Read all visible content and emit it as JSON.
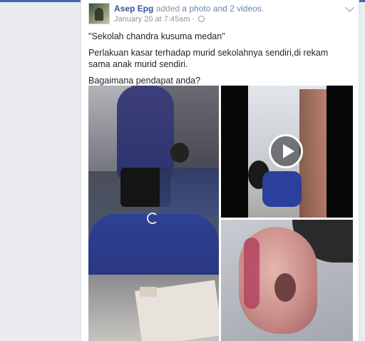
{
  "post": {
    "author": "Asep Epg",
    "action": "added",
    "action_link": "a photo and 2 videos",
    "action_suffix": ".",
    "timestamp": "January 20 at 7:45am",
    "separator": "·",
    "privacy_icon": "globe-icon",
    "paragraphs": [
      "\"Sekolah chandra kusuma medan\"",
      "Perlakuan kasar terhadap murid sekolahnya sendiri,di rekam sama anak murid sendiri.",
      "Bagaimana pendapat anda?"
    ],
    "media": [
      {
        "kind": "photo",
        "icon": "loading-spinner-icon"
      },
      {
        "kind": "video",
        "icon": "play-icon"
      },
      {
        "kind": "photo"
      }
    ]
  },
  "colors": {
    "link": "#365899",
    "text": "#1d2129",
    "meta": "#90949c",
    "background": "#e9ebee",
    "brand_bar": "#4267b2"
  }
}
